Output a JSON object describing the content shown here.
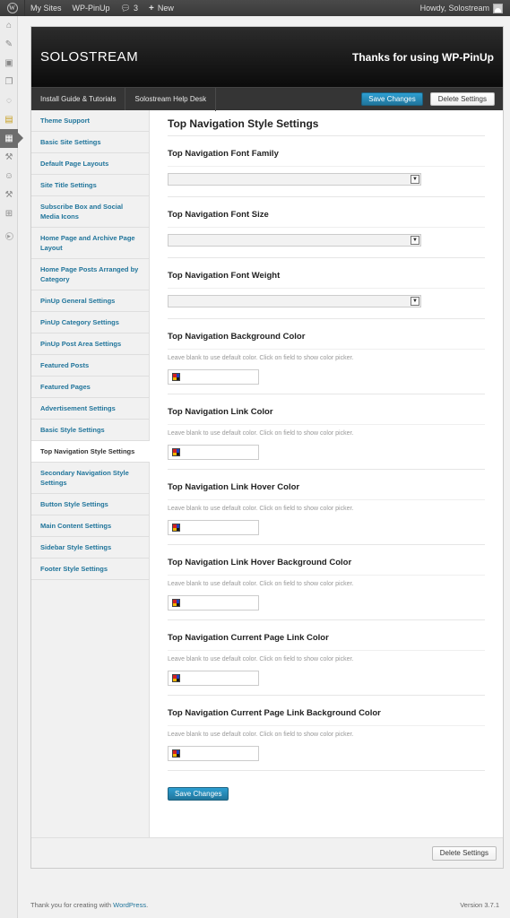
{
  "adminbar": {
    "my_sites": "My Sites",
    "site_name": "WP-PinUp",
    "comments_count": "3",
    "new_label": "New",
    "howdy": "Howdy, Solostream"
  },
  "theme": {
    "brand": "SOLOSTREAM",
    "thanks": "Thanks for using WP-PinUp",
    "nav": [
      "Install Guide & Tutorials",
      "Solostream Help Desk"
    ],
    "save_label": "Save Changes",
    "delete_label": "Delete Settings"
  },
  "sidebar": {
    "items": [
      "Theme Support",
      "Basic Site Settings",
      "Default Page Layouts",
      "Site Title Settings",
      "Subscribe Box and Social Media Icons",
      "Home Page and Archive Page Layout",
      "Home Page Posts Arranged by Category",
      "PinUp General Settings",
      "PinUp Category Settings",
      "PinUp Post Area Settings",
      "Featured Posts",
      "Featured Pages",
      "Advertisement Settings",
      "Basic Style Settings",
      "Top Navigation Style Settings",
      "Secondary Navigation Style Settings",
      "Button Style Settings",
      "Main Content Settings",
      "Sidebar Style Settings",
      "Footer Style Settings"
    ],
    "active_index": 14
  },
  "content": {
    "title": "Top Navigation Style Settings",
    "selects": [
      {
        "label": "Top Navigation Font Family",
        "value": ""
      },
      {
        "label": "Top Navigation Font Size",
        "value": ""
      },
      {
        "label": "Top Navigation Font Weight",
        "value": ""
      }
    ],
    "color_fields": [
      {
        "label": "Top Navigation Background Color",
        "desc": "Leave blank to use default color. Click on field to show color picker."
      },
      {
        "label": "Top Navigation Link Color",
        "desc": "Leave blank to use default color. Click on field to show color picker."
      },
      {
        "label": "Top Navigation Link Hover Color",
        "desc": "Leave blank to use default color. Click on field to show color picker."
      },
      {
        "label": "Top Navigation Link Hover Background Color",
        "desc": "Leave blank to use default color. Click on field to show color picker."
      },
      {
        "label": "Top Navigation Current Page Link Color",
        "desc": "Leave blank to use default color. Click on field to show color picker."
      },
      {
        "label": "Top Navigation Current Page Link Background Color",
        "desc": "Leave blank to use default color. Click on field to show color picker."
      }
    ],
    "save_label": "Save Changes"
  },
  "panel_footer": {
    "delete_label": "Delete Settings"
  },
  "footer": {
    "thanks_prefix": "Thank you for creating with ",
    "wordpress": "WordPress",
    "thanks_suffix": ".",
    "version": "Version 3.7.1"
  },
  "colors": {
    "accent": "#21759b",
    "header_dark": "#111111",
    "swatch": [
      "#d42020",
      "#1d3fbf",
      "#f0b400",
      "#1a1a1a"
    ]
  }
}
